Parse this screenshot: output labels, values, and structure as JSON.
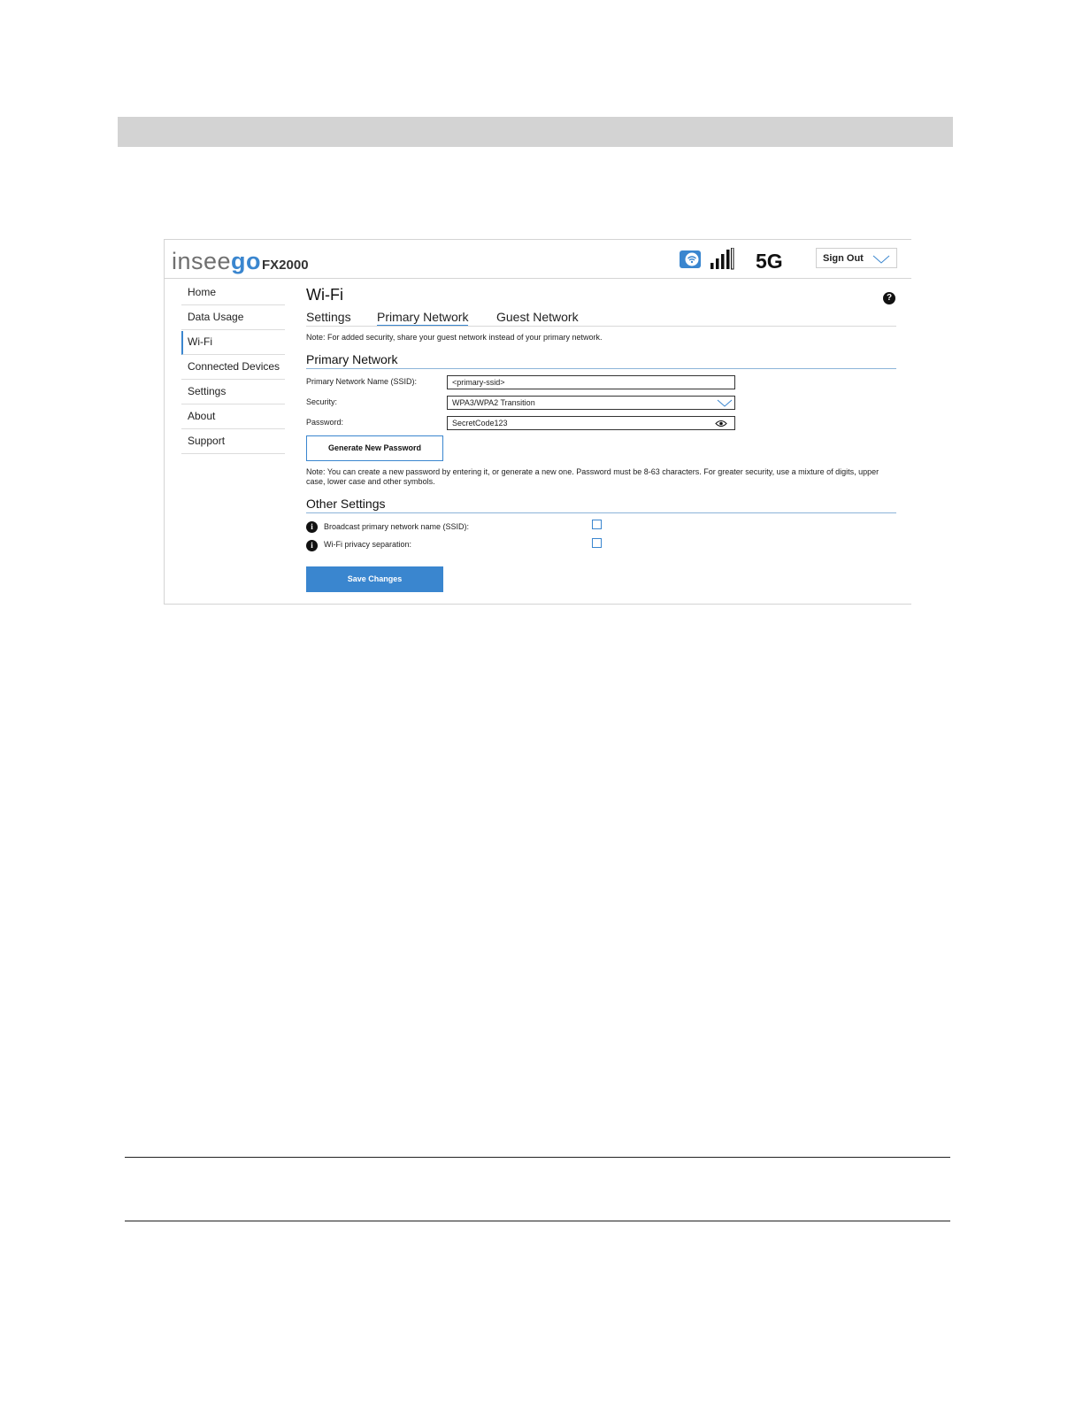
{
  "header": {
    "logo_main": "insee",
    "logo_accent": "go",
    "model": "FX2000",
    "network_type": "5G",
    "sign_out_label": "Sign Out"
  },
  "sidebar": {
    "items": [
      {
        "label": "Home"
      },
      {
        "label": "Data Usage"
      },
      {
        "label": "Wi-Fi"
      },
      {
        "label": "Connected Devices"
      },
      {
        "label": "Settings"
      },
      {
        "label": "About"
      },
      {
        "label": "Support"
      }
    ],
    "active_index": 2
  },
  "main": {
    "title": "Wi-Fi",
    "help_glyph": "?",
    "tabs": [
      {
        "label": "Settings"
      },
      {
        "label": "Primary Network"
      },
      {
        "label": "Guest Network"
      }
    ],
    "active_tab": 1,
    "top_note": "Note: For added security, share your guest network instead of your primary network.",
    "primary_section": {
      "title": "Primary Network",
      "ssid_label": "Primary Network Name (SSID):",
      "ssid_value": "<primary-ssid>",
      "security_label": "Security:",
      "security_value": "WPA3/WPA2 Transition",
      "password_label": "Password:",
      "password_value": "SecretCode123",
      "generate_button": "Generate New Password",
      "password_note": "Note: You can create a new password by entering it, or generate a new one. Password must be 8-63 characters. For greater security, use a mixture of digits, upper case, lower case and other symbols."
    },
    "other_section": {
      "title": "Other Settings",
      "info_glyph": "i",
      "options": [
        {
          "label": "Broadcast primary network name (SSID):",
          "checked": false
        },
        {
          "label": "Wi-Fi privacy separation:",
          "checked": false
        }
      ]
    },
    "save_button": "Save Changes"
  },
  "colors": {
    "accent": "#3a86cf",
    "header_band": "#d3d3d3"
  }
}
